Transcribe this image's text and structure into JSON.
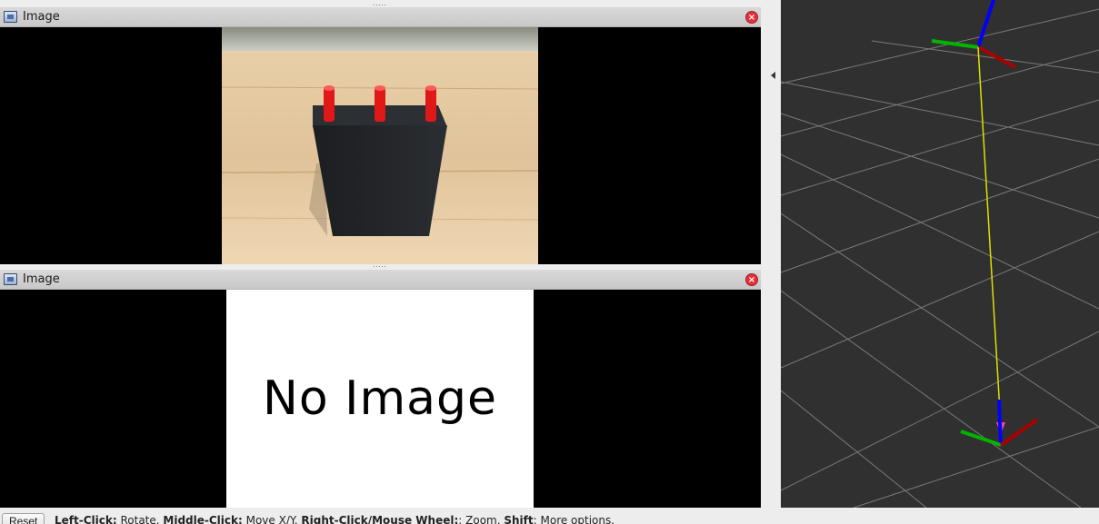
{
  "panels": [
    {
      "title": "Image"
    },
    {
      "title": "Image",
      "no_image_text": "No Image"
    }
  ],
  "icons": {
    "panel_icon": "image-panel-icon",
    "close": "close-icon",
    "splitter_arrow": "arrow-left-icon"
  },
  "colors": {
    "close_red": "#e5303b",
    "viewer_background": "#303030",
    "axis_x": "#aa0000",
    "axis_y": "#00b400",
    "axis_z": "#0000ff",
    "link_line": "#e0e000"
  },
  "status": {
    "reset_label": "Reset",
    "hints": [
      {
        "key": "Left-Click:",
        "value": " Rotate. "
      },
      {
        "key": "Middle-Click:",
        "value": " Move X/Y. "
      },
      {
        "key": "Right-Click/Mouse Wheel:",
        "value": ": Zoom. "
      },
      {
        "key": "Shift",
        "value": ": More options."
      }
    ]
  }
}
